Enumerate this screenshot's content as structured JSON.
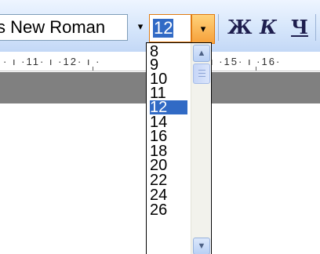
{
  "toolbar": {
    "font_name": "s New Roman",
    "font_dropdown_arrow": "▾",
    "font_size_value": "12",
    "size_dropdown_arrow": "▾",
    "bold_label": "Ж",
    "italic_label": "К",
    "underline_label": "Ч"
  },
  "ruler": {
    "left_ticks": "· ı ·11· ı ·12· ı ·",
    "right_ticks": "ı ·15· ı ·16·"
  },
  "size_list": {
    "items": [
      "8",
      "9",
      "10",
      "11",
      "12",
      "14",
      "16",
      "18",
      "20",
      "22",
      "24",
      "26"
    ],
    "selected": "12"
  },
  "scrollbar": {
    "up_arrow": "▲",
    "down_arrow": "▼"
  },
  "colors": {
    "selection": "#316ac5",
    "highlight_border": "#e07b12",
    "toolbar_bg": "#d6e6fb"
  }
}
